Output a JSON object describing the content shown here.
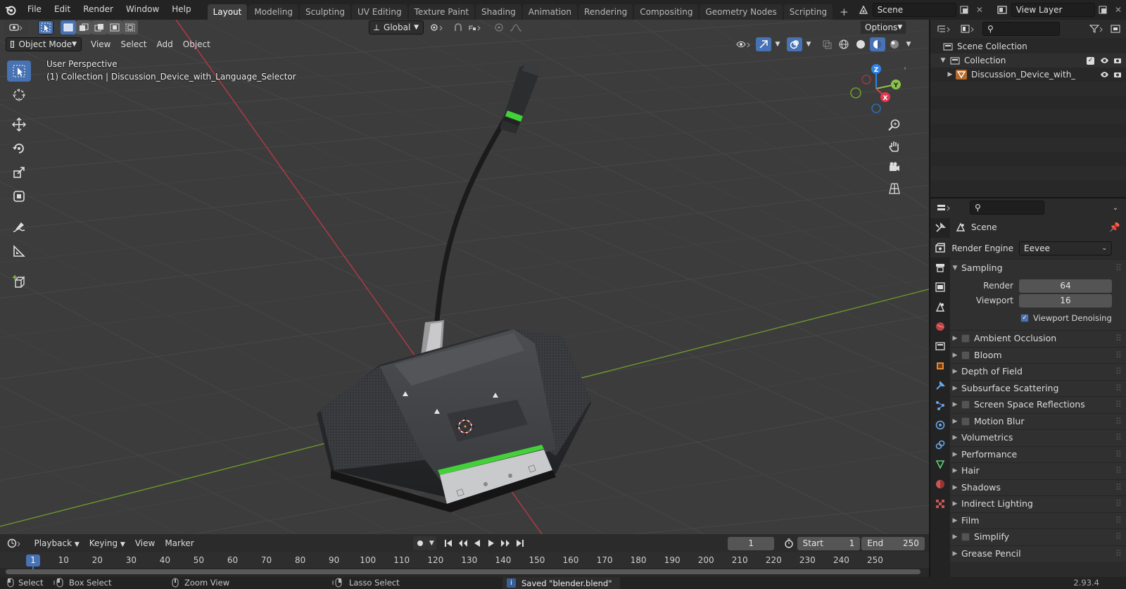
{
  "menu": {
    "items": [
      "File",
      "Edit",
      "Render",
      "Window",
      "Help"
    ]
  },
  "workspaces": [
    "Layout",
    "Modeling",
    "Sculpting",
    "UV Editing",
    "Texture Paint",
    "Shading",
    "Animation",
    "Rendering",
    "Compositing",
    "Geometry Nodes",
    "Scripting"
  ],
  "active_workspace": "Layout",
  "scene_field": "Scene",
  "view_layer_field": "View Layer",
  "toolbar": {
    "orientation": "Global",
    "options_label": "Options"
  },
  "viewport_header": {
    "mode": "Object Mode",
    "menus": [
      "View",
      "Select",
      "Add",
      "Object"
    ]
  },
  "overlay_text": {
    "perspective": "User Perspective",
    "collection_info": "(1) Collection | Discussion_Device_with_Language_Selector"
  },
  "gizmo": {
    "x": "X",
    "y": "Y",
    "z": "Z"
  },
  "outliner": {
    "scene_collection": "Scene Collection",
    "collection": "Collection",
    "object": "Discussion_Device_with_"
  },
  "properties": {
    "context": "Scene",
    "render_engine_label": "Render Engine",
    "render_engine_value": "Eevee",
    "sampling_label": "Sampling",
    "render_label": "Render",
    "render_value": "64",
    "viewport_label": "Viewport",
    "viewport_value": "16",
    "denoise_label": "Viewport Denoising",
    "panels": [
      {
        "label": "Ambient Occlusion",
        "checkbox": true
      },
      {
        "label": "Bloom",
        "checkbox": true
      },
      {
        "label": "Depth of Field",
        "checkbox": false
      },
      {
        "label": "Subsurface Scattering",
        "checkbox": false
      },
      {
        "label": "Screen Space Reflections",
        "checkbox": true
      },
      {
        "label": "Motion Blur",
        "checkbox": true
      },
      {
        "label": "Volumetrics",
        "checkbox": false
      },
      {
        "label": "Performance",
        "checkbox": false
      },
      {
        "label": "Hair",
        "checkbox": false
      },
      {
        "label": "Shadows",
        "checkbox": false
      },
      {
        "label": "Indirect Lighting",
        "checkbox": false
      },
      {
        "label": "Film",
        "checkbox": false
      },
      {
        "label": "Simplify",
        "checkbox": true
      },
      {
        "label": "Grease Pencil",
        "checkbox": false
      }
    ]
  },
  "timeline": {
    "menus": [
      "Playback",
      "Keying",
      "View",
      "Marker"
    ],
    "current_frame": "1",
    "start_label": "Start",
    "start_value": "1",
    "end_label": "End",
    "end_value": "250",
    "ruler": [
      "1",
      "10",
      "20",
      "30",
      "40",
      "50",
      "60",
      "70",
      "80",
      "90",
      "100",
      "110",
      "120",
      "130",
      "140",
      "150",
      "160",
      "170",
      "180",
      "190",
      "200",
      "210",
      "220",
      "230",
      "240",
      "250"
    ]
  },
  "status": {
    "select": "Select",
    "box_select": "Box Select",
    "zoom_view": "Zoom View",
    "lasso_select": "Lasso Select",
    "message": "Saved \"blender.blend\"",
    "version": "2.93.4"
  },
  "colors": {
    "accent": "#4772b3",
    "x_axis": "#e2384d",
    "y_axis": "#8bc34a",
    "z_axis": "#2f82e8",
    "led": "#43d13a"
  }
}
